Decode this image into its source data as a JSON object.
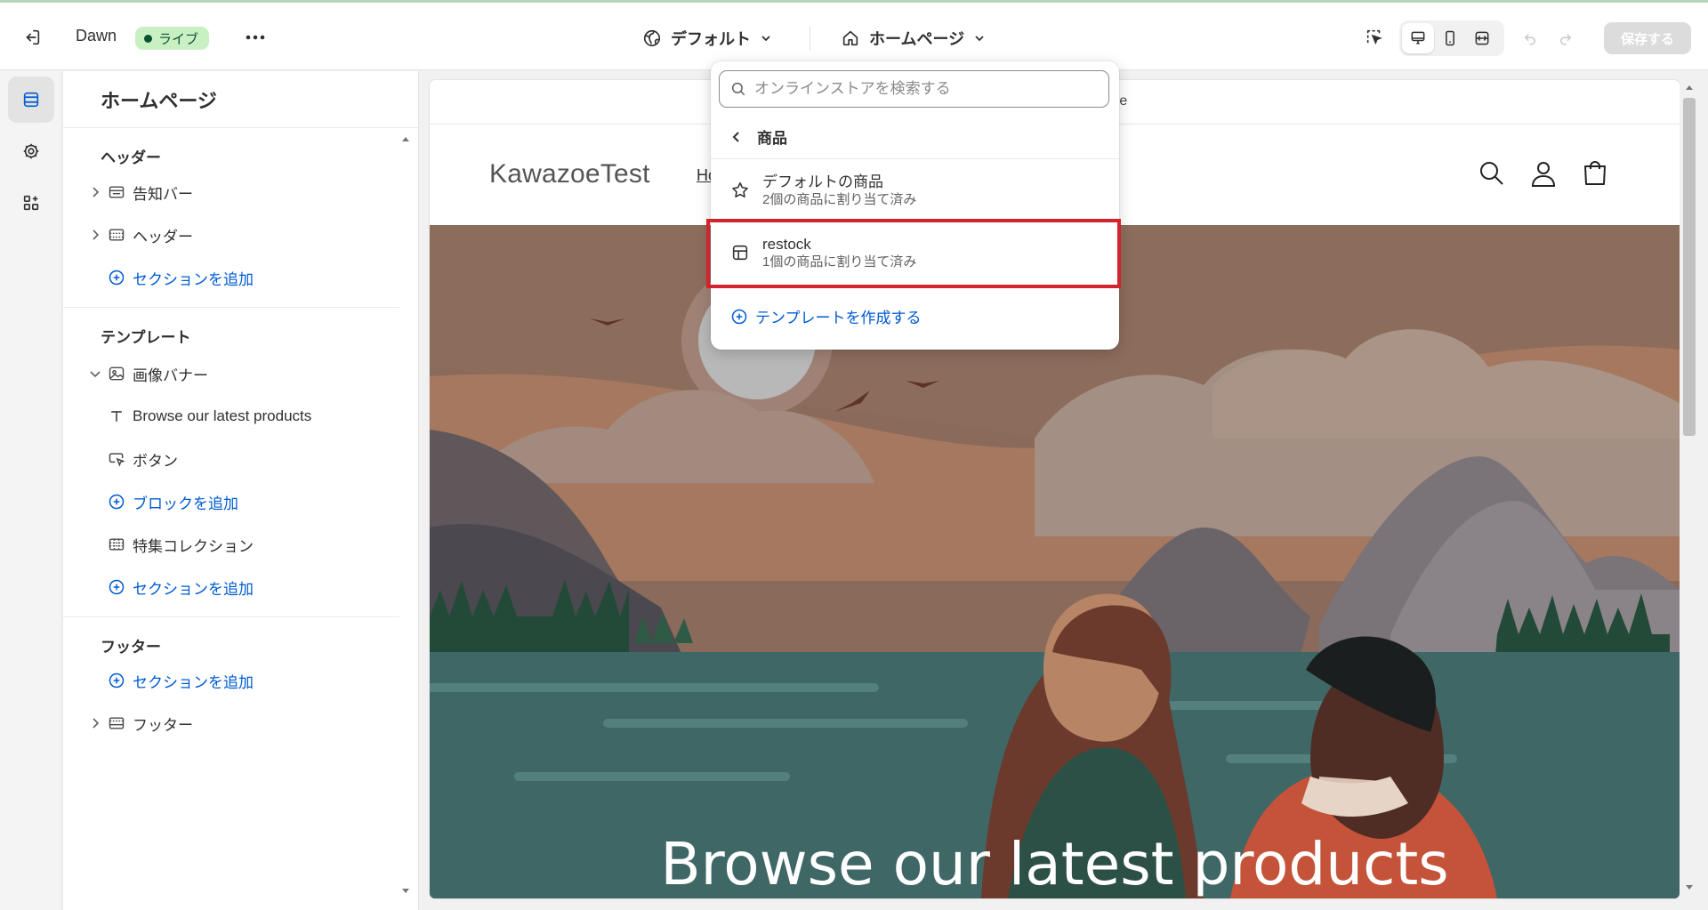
{
  "topbar": {
    "theme_name": "Dawn",
    "live_badge": "ライブ",
    "market_selector": "デフォルト",
    "page_selector": "ホームページ",
    "save_label": "保存する"
  },
  "sidebar": {
    "title": "ホームページ",
    "header_group": {
      "label": "ヘッダー",
      "items": [
        "告知バー",
        "ヘッダー"
      ],
      "add_section": "セクションを追加"
    },
    "template_group": {
      "label": "テンプレート",
      "image_banner": "画像バナー",
      "blocks": [
        "Browse our latest products",
        "ボタン"
      ],
      "add_block": "ブロックを追加",
      "featured_collection": "特集コレクション",
      "add_section": "セクションを追加"
    },
    "footer_group": {
      "label": "フッター",
      "add_section": "セクションを追加",
      "items": [
        "フッター"
      ]
    }
  },
  "preview": {
    "announcement_text": "re",
    "store_name": "KawazoeTest",
    "nav_home": "Ho",
    "hero_heading": "Browse our latest products"
  },
  "dropdown": {
    "search_placeholder": "オンラインストアを検索する",
    "back_label": "商品",
    "templates": [
      {
        "name": "デフォルトの商品",
        "assigned": "2個の商品に割り当て済み",
        "icon": "star-icon"
      },
      {
        "name": "restock",
        "assigned": "1個の商品に割り当て済み",
        "icon": "layout-icon",
        "highlighted": true
      }
    ],
    "create_template": "テンプレートを作成する"
  },
  "colors": {
    "accent_blue": "#005bd3",
    "live_green": "#c9f0c3",
    "highlight_red": "#d1242f"
  }
}
